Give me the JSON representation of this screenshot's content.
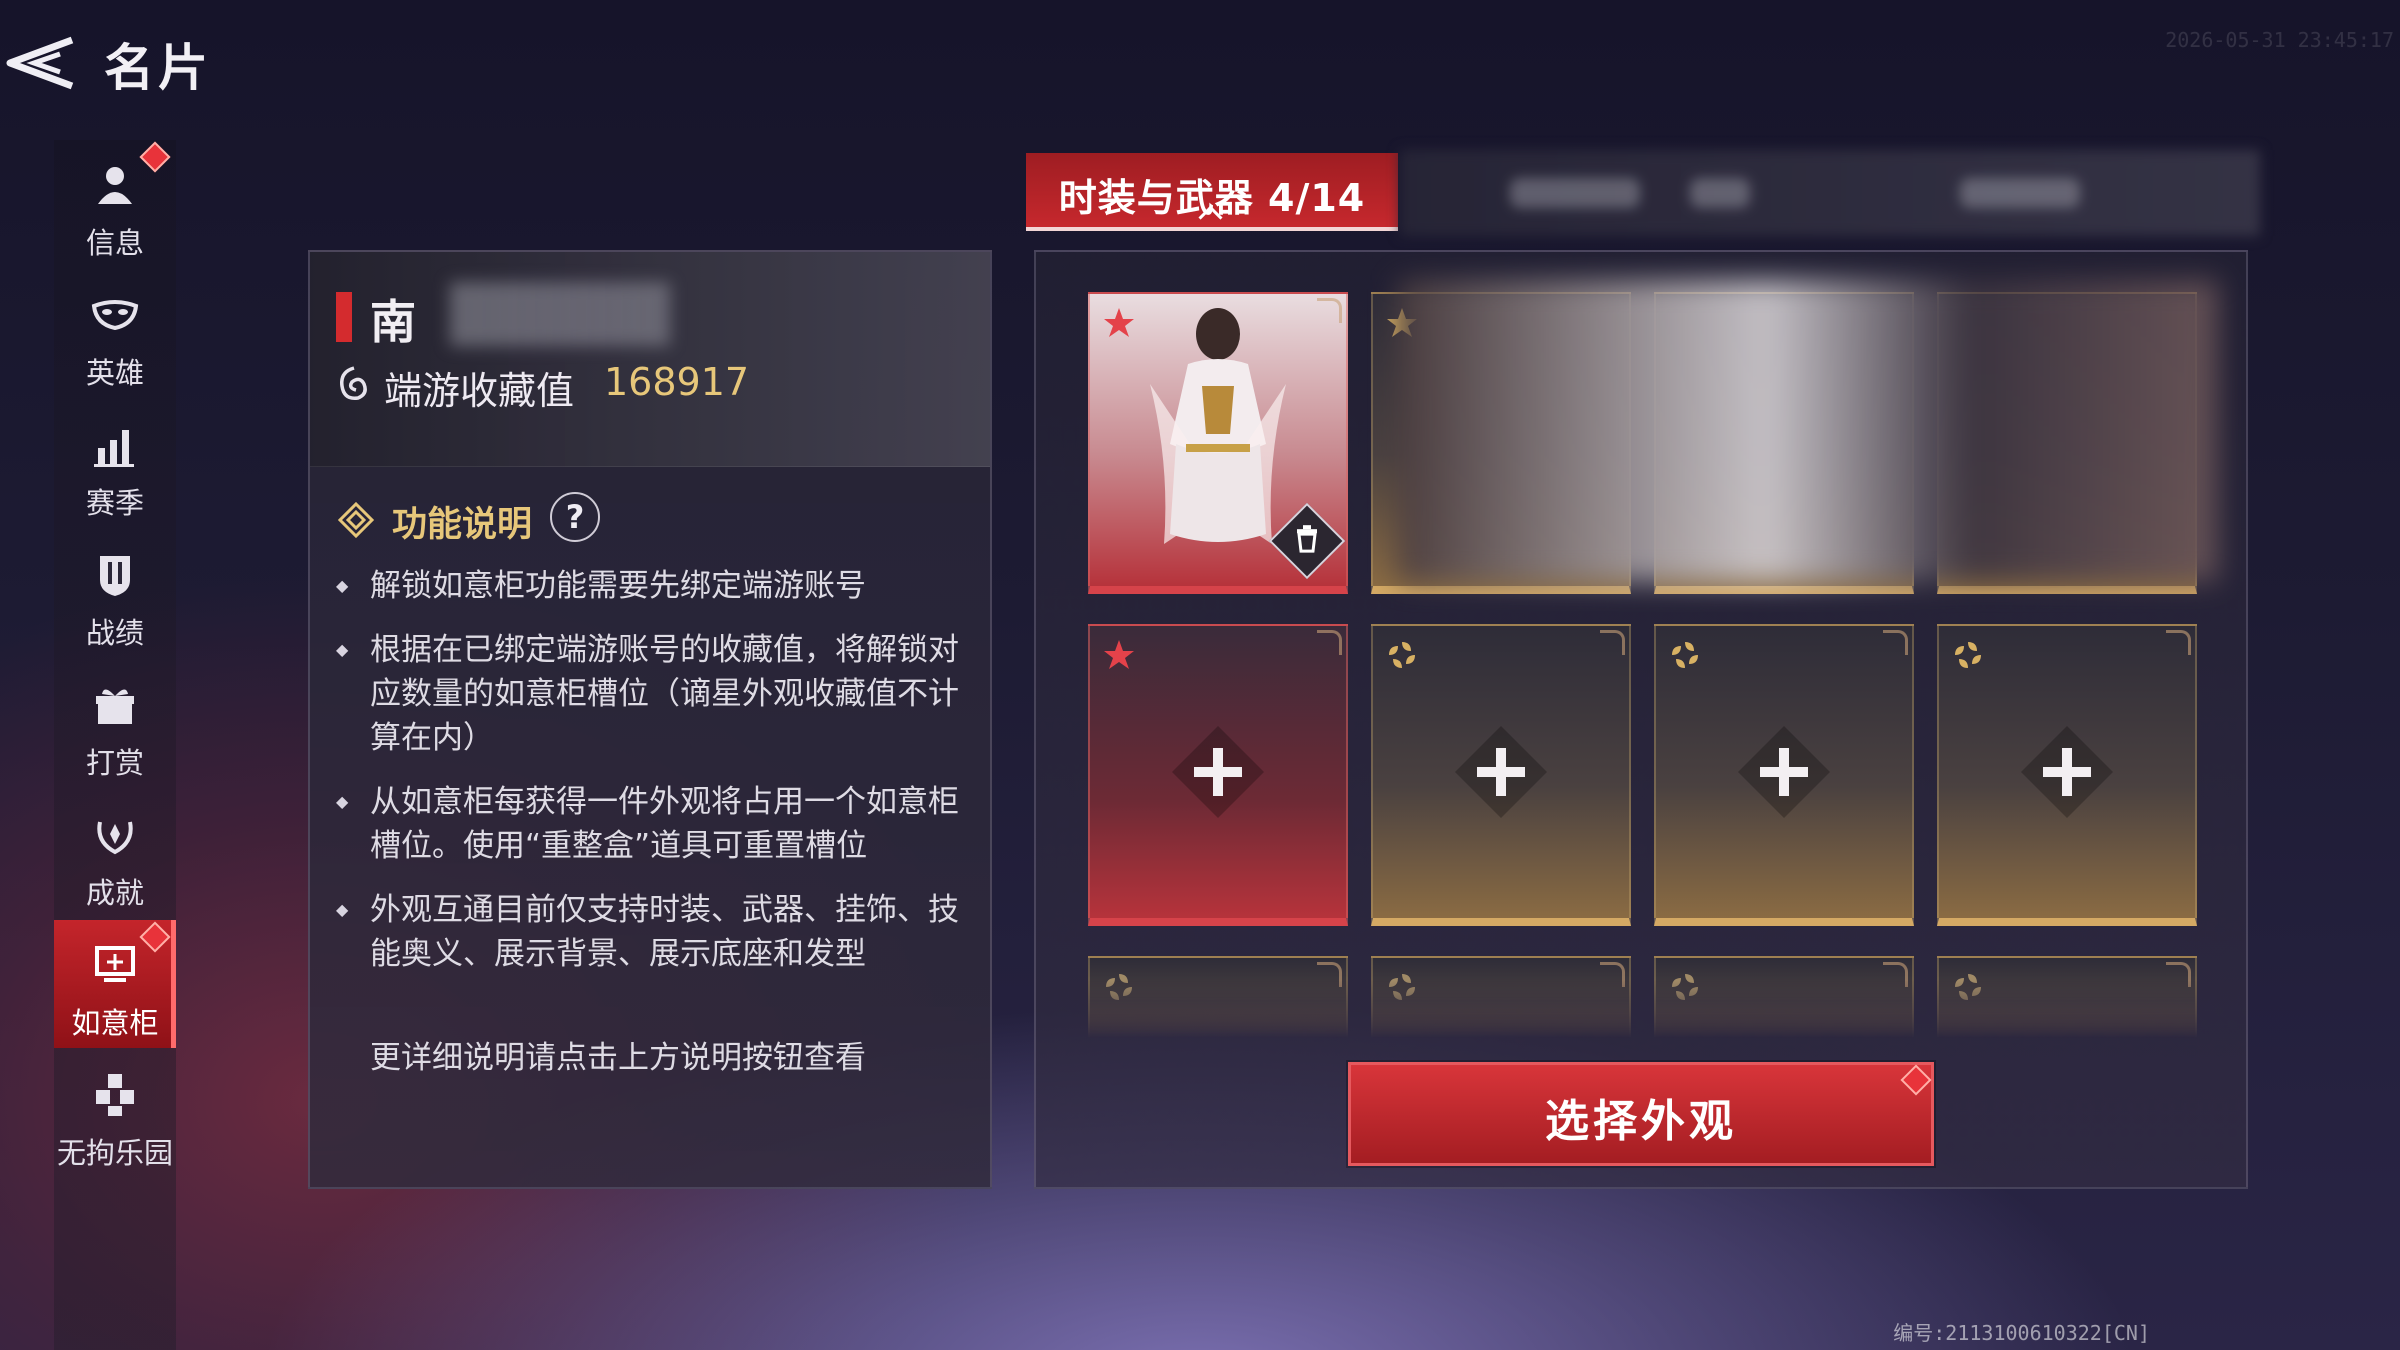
{
  "header": {
    "title": "名片",
    "timestamp": "2026-05-31 23:45:17"
  },
  "sidebar": {
    "items": [
      {
        "label": "信息",
        "icon": "person-icon",
        "badge": true
      },
      {
        "label": "英雄",
        "icon": "mask-icon",
        "badge": false
      },
      {
        "label": "赛季",
        "icon": "bar-chart-icon",
        "badge": false
      },
      {
        "label": "战绩",
        "icon": "shield-icon",
        "badge": false
      },
      {
        "label": "打赏",
        "icon": "gift-icon",
        "badge": false
      },
      {
        "label": "成就",
        "icon": "laurel-icon",
        "badge": false
      },
      {
        "label": "如意柜",
        "icon": "cabinet-icon",
        "badge": true,
        "active": true
      },
      {
        "label": "无拘乐园",
        "icon": "blocks-icon",
        "badge": false
      }
    ]
  },
  "info": {
    "name": "南",
    "collection_label": "端游收藏值",
    "collection_value": "168917",
    "func_title": "功能说明",
    "help": "?",
    "bullets": [
      "解锁如意柜功能需要先绑定端游账号",
      "根据在已绑定端游账号的收藏值，将解锁对应数量的如意柜槽位（谪星外观收藏值不计算在内）",
      "从如意柜每获得一件外观将占用一个如意柜槽位。使用“重整盒”道具可重置槽位",
      "外观互通目前仅支持时装、武器、挂饰、技能奥义、展示背景、展示底座和发型"
    ],
    "footer_note": "更详细说明请点击上方说明按钮查看"
  },
  "tabs": {
    "active_label": "时装与武器",
    "active_count": "4/14"
  },
  "grid": {
    "row1": [
      "filled-red",
      "blurred",
      "blurred",
      "blurred"
    ],
    "row2": [
      "empty-red",
      "empty-gold",
      "empty-gold",
      "empty-gold"
    ],
    "row3": [
      "partial",
      "partial",
      "partial",
      "partial"
    ]
  },
  "select_button": "选择外观",
  "serial": "编号:2113100610322[CN]",
  "colors": {
    "accent_red": "#c6282d",
    "gold": "#e7c77a",
    "slot_gold": "#d4a964"
  }
}
